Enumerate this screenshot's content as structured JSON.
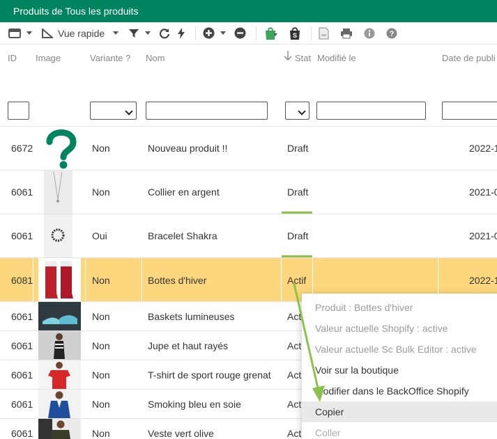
{
  "title": "Produits de Tous les produits",
  "toolbar": {
    "quick_view_label": "Vue rapide"
  },
  "columns": [
    "ID",
    "Image",
    "Variante ?",
    "Nom",
    "Stat",
    "Modifié le",
    "Date de publi"
  ],
  "rows": [
    {
      "id": "6672",
      "variant": "Non",
      "name": "Nouveau produit !!",
      "status": "Draft",
      "date": "2022-1",
      "thumb": "question-mark"
    },
    {
      "id": "6061",
      "variant": "Non",
      "name": "Collier en argent",
      "status": "Draft",
      "date": "2021-0",
      "thumb": "necklace"
    },
    {
      "id": "6061",
      "variant": "Oui",
      "name": "Bracelet Shakra",
      "status": "Draft",
      "date": "2021-0",
      "thumb": "bracelet"
    },
    {
      "id": "6081",
      "variant": "Non",
      "name": "Bottes d'hiver",
      "status": "Actif",
      "date": "2022-1",
      "thumb": "boots"
    },
    {
      "id": "6061",
      "variant": "Non",
      "name": "Baskets lumineuses",
      "status": "Act",
      "date": "",
      "thumb": "sneakers"
    },
    {
      "id": "6061",
      "variant": "Non",
      "name": "Jupe et haut rayés",
      "status": "Act",
      "date": "",
      "thumb": "woman-striped"
    },
    {
      "id": "6061",
      "variant": "Non",
      "name": "T-shirt de sport rouge grenat",
      "status": "Act",
      "date": "",
      "thumb": "red-tshirt"
    },
    {
      "id": "6061",
      "variant": "Non",
      "name": "Smoking bleu en soie",
      "status": "Act",
      "date": "",
      "thumb": "man-suit"
    },
    {
      "id": "6061",
      "variant": "Non",
      "name": "Veste vert olive",
      "status": "Act",
      "date": "",
      "thumb": "man-jacket"
    }
  ],
  "context_menu": [
    {
      "label": "Produit : Bottes d'hiver",
      "state": "disabled"
    },
    {
      "label": "Valeur actuelle Shopify : active",
      "state": "disabled"
    },
    {
      "label": "Valeur actuelle Sc Bulk Editor : active",
      "state": "disabled"
    },
    {
      "label": "Voir sur la boutique",
      "state": "enabled"
    },
    {
      "label": "Modifier dans le BackOffice Shopify",
      "state": "enabled"
    },
    {
      "label": "Copier",
      "state": "hover"
    },
    {
      "label": "Coller",
      "state": "disabled"
    }
  ],
  "colors": {
    "title_bg": "#00845f",
    "selected_row": "#fdd77d",
    "arrow": "#8bc34a"
  }
}
